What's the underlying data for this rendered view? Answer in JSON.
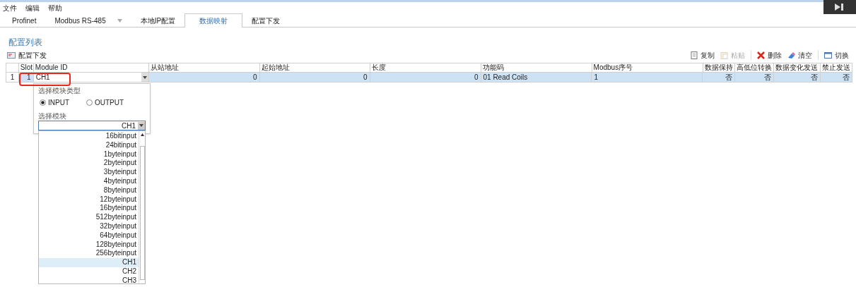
{
  "menu": [
    "文件",
    "编辑",
    "帮助"
  ],
  "tabs": [
    {
      "label": "Profinet",
      "selected": false,
      "dropdown": false
    },
    {
      "label": "Modbus RS-485",
      "selected": false,
      "dropdown": true
    },
    {
      "label": "本地IP配置",
      "selected": false,
      "dropdown": false
    },
    {
      "label": "数据映射",
      "selected": true,
      "dropdown": false
    },
    {
      "label": "配置下发",
      "selected": false,
      "dropdown": false
    }
  ],
  "section_title": "配置列表",
  "download_button": "配置下发",
  "toolbar": [
    {
      "label": "复制",
      "kind": "copy",
      "disabled": false
    },
    {
      "label": "粘贴",
      "kind": "paste",
      "disabled": true
    },
    {
      "label": "删除",
      "kind": "delete",
      "disabled": false
    },
    {
      "label": "清空",
      "kind": "clear",
      "disabled": false
    },
    {
      "label": "切换",
      "kind": "switch",
      "disabled": false
    }
  ],
  "table": {
    "columns": [
      "",
      "Slot",
      "Module ID",
      "从站地址",
      "起始地址",
      "长度",
      "功能码",
      "Modbus序号",
      "数据保持",
      "高低位转换",
      "数据变化发送",
      "禁止发送"
    ],
    "rows": [
      {
        "selected": true,
        "cells": [
          "1",
          "1",
          "CH1",
          "0",
          "0",
          "0",
          "01 Read Coils",
          "1",
          "否",
          "否",
          "否",
          "否"
        ]
      }
    ]
  },
  "editor": {
    "type_label": "选择模块类型",
    "types": [
      {
        "label": "INPUT",
        "selected": true
      },
      {
        "label": "OUTPUT",
        "selected": false
      }
    ],
    "module_label": "选择模块",
    "module_value": "CH1",
    "options": [
      {
        "label": "16bitinput",
        "selected": false
      },
      {
        "label": "24bitinput",
        "selected": false
      },
      {
        "label": "1byteinput",
        "selected": false
      },
      {
        "label": "2byteinput",
        "selected": false
      },
      {
        "label": "3byteinput",
        "selected": false
      },
      {
        "label": "4byteinput",
        "selected": false
      },
      {
        "label": "8byteinput",
        "selected": false
      },
      {
        "label": "12byteinput",
        "selected": false
      },
      {
        "label": "16byteinput",
        "selected": false
      },
      {
        "label": "512byteinput",
        "selected": false
      },
      {
        "label": "32byteinput",
        "selected": false
      },
      {
        "label": "64byteinput",
        "selected": false
      },
      {
        "label": "128byteinput",
        "selected": false
      },
      {
        "label": "256byteinput",
        "selected": false
      },
      {
        "label": "CH1",
        "selected": true
      },
      {
        "label": "CH2",
        "selected": false
      },
      {
        "label": "CH3",
        "selected": false
      }
    ]
  }
}
